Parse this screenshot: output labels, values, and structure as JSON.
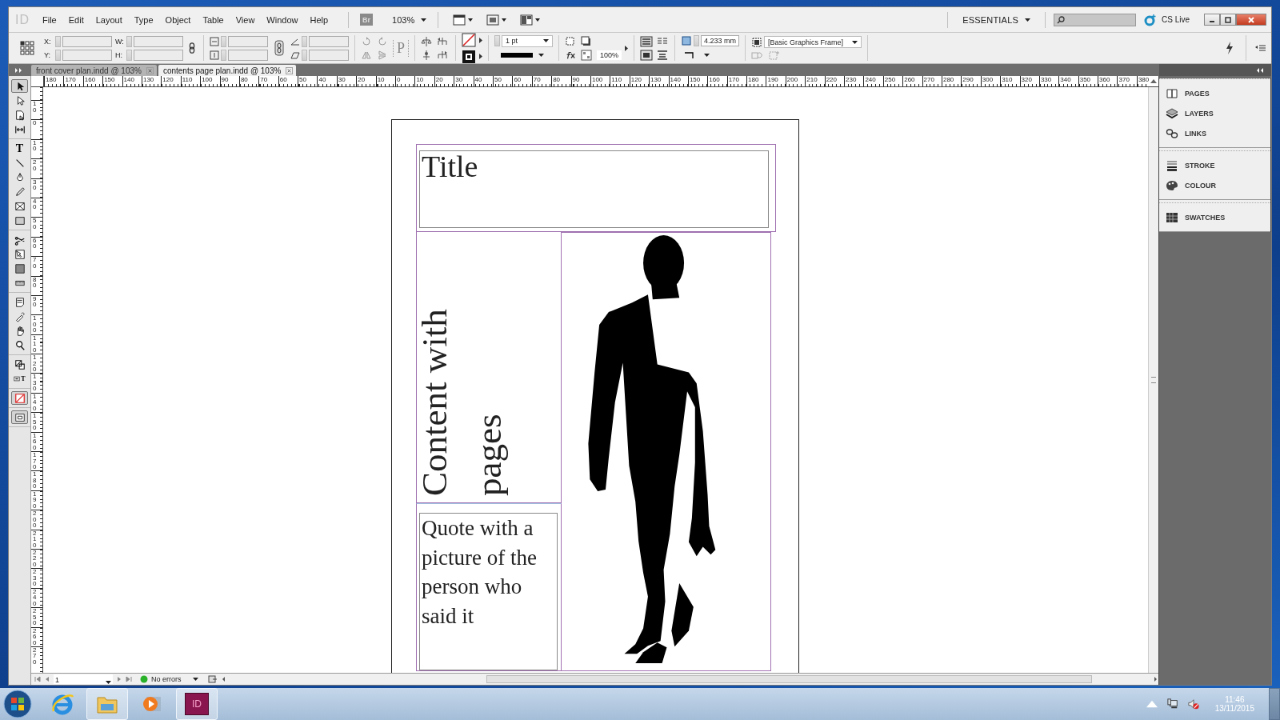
{
  "menu_bar": {
    "logo": "ID",
    "items": [
      "File",
      "Edit",
      "Layout",
      "Type",
      "Object",
      "Table",
      "View",
      "Window",
      "Help"
    ],
    "bridge": "Br",
    "zoom": "103%",
    "workspace": "ESSENTIALS",
    "cs_live": "CS Live"
  },
  "control_panel": {
    "position_labels": [
      "X:",
      "Y:"
    ],
    "size_labels": [
      "W:",
      "H:"
    ],
    "glyph": "P",
    "stroke_weight": "1 pt",
    "opacity": "100%",
    "offset": "4.233 mm",
    "object_style": "[Basic Graphics Frame]"
  },
  "tabs": [
    {
      "label": "front cover plan.indd @ 103%",
      "selected": false
    },
    {
      "label": "contents page plan.indd @ 103%",
      "selected": true
    }
  ],
  "tool_groups": [
    {
      "tools": [
        {
          "kind": "selection",
          "selected": true
        },
        {
          "kind": "direct-selection",
          "selected": false
        },
        {
          "kind": "page",
          "selected": false
        },
        {
          "kind": "gap",
          "selected": false
        }
      ]
    },
    {
      "tools": [
        {
          "kind": "type",
          "glyph": "T",
          "selected": false
        },
        {
          "kind": "line",
          "selected": false
        },
        {
          "kind": "pen",
          "selected": false
        },
        {
          "kind": "pencil",
          "selected": false
        },
        {
          "kind": "frame",
          "selected": false
        },
        {
          "kind": "rectangle",
          "selected": false
        }
      ]
    },
    {
      "tools": [
        {
          "kind": "scissors",
          "selected": false
        },
        {
          "kind": "free-transform",
          "selected": false
        },
        {
          "kind": "gradient",
          "selected": false
        },
        {
          "kind": "feather",
          "selected": false
        }
      ]
    },
    {
      "tools": [
        {
          "kind": "note",
          "selected": false
        },
        {
          "kind": "eyedropper",
          "selected": false
        },
        {
          "kind": "hand",
          "selected": false
        },
        {
          "kind": "zoom",
          "selected": false
        }
      ]
    },
    {
      "tools": [
        {
          "kind": "fill-stroke",
          "selected": false
        },
        {
          "kind": "formatting",
          "glyph": "T",
          "selected": false
        }
      ]
    },
    {
      "tools": [
        {
          "kind": "none",
          "selected": true
        }
      ]
    },
    {
      "tools": [
        {
          "kind": "screen-mode",
          "selected": true
        }
      ]
    }
  ],
  "rulers": {
    "horizontal": [
      "180",
      "170",
      "160",
      "150",
      "140",
      "130",
      "120",
      "110",
      "100",
      "90",
      "80",
      "70",
      "60",
      "50",
      "40",
      "30",
      "20",
      "10",
      "0",
      "10",
      "20",
      "30",
      "40",
      "50",
      "60",
      "70",
      "80",
      "90",
      "100",
      "110",
      "120",
      "130",
      "140",
      "150",
      "160",
      "170",
      "180",
      "190",
      "200",
      "210",
      "220",
      "230",
      "240",
      "250",
      "260",
      "270",
      "280",
      "290",
      "300",
      "310",
      "320",
      "330",
      "340",
      "350",
      "360",
      "370",
      "380"
    ],
    "vertical": [
      "10",
      "0",
      "10",
      "20",
      "30",
      "40",
      "50",
      "60",
      "70",
      "80",
      "90",
      "100",
      "110",
      "120",
      "130",
      "140",
      "150",
      "160",
      "170",
      "180",
      "190",
      "200",
      "210",
      "220",
      "230",
      "240",
      "250",
      "260",
      "270"
    ]
  },
  "page": {
    "title": "Title",
    "vertical_text": "Content with pages",
    "quote": "Quote with a picture of the person who said it"
  },
  "panel_groups": [
    {
      "items": [
        {
          "label": "PAGES",
          "kind": "pages"
        },
        {
          "label": "LAYERS",
          "kind": "layers"
        },
        {
          "label": "LINKS",
          "kind": "links"
        }
      ]
    },
    {
      "items": [
        {
          "label": "STROKE",
          "kind": "stroke"
        },
        {
          "label": "COLOUR",
          "kind": "colour"
        }
      ]
    },
    {
      "items": [
        {
          "label": "SWATCHES",
          "kind": "swatches"
        }
      ]
    }
  ],
  "status_bar": {
    "page": "1",
    "preflight": "No errors"
  },
  "taskbar": {
    "apps": [
      {
        "kind": "ie",
        "running": false
      },
      {
        "kind": "explorer",
        "running": true
      },
      {
        "kind": "media",
        "running": false
      },
      {
        "kind": "indesign",
        "glyph": "ID",
        "running": true
      }
    ],
    "time": "11:46",
    "date": "13/11/2015"
  }
}
